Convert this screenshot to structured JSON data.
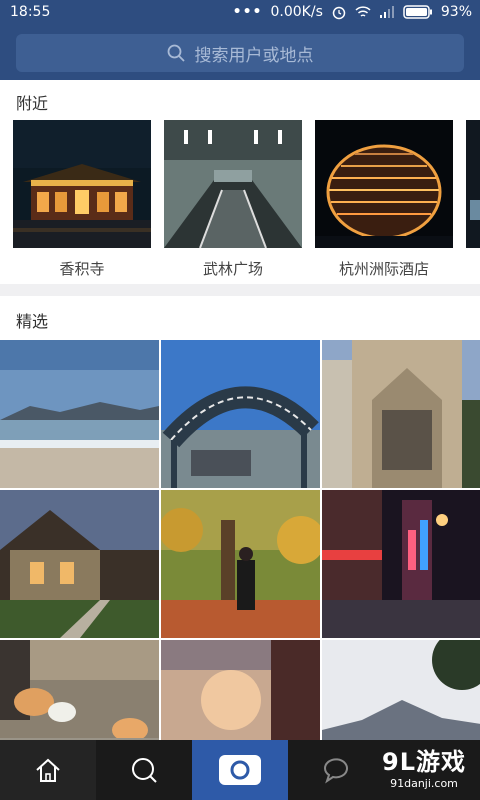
{
  "status_bar": {
    "time": "18:55",
    "network_speed": "0.00K/s",
    "battery": "93%"
  },
  "search": {
    "placeholder": "搜索用户或地点"
  },
  "nearby": {
    "title": "附近",
    "places": [
      {
        "name": "香积寺"
      },
      {
        "name": "武林广场"
      },
      {
        "name": "杭州洲际酒店"
      }
    ]
  },
  "featured": {
    "title": "精选"
  },
  "bottom_nav": {
    "items": [
      "home-icon",
      "search-icon",
      "camera-icon",
      "comment-icon"
    ],
    "active_color": "#2e5aa8"
  },
  "watermark": {
    "brand": "9L游戏",
    "site": "91danji.com"
  },
  "colors": {
    "header": "#2e4d80",
    "search_bg": "#3e5f93",
    "nav_dark": "#1a1a1a"
  }
}
